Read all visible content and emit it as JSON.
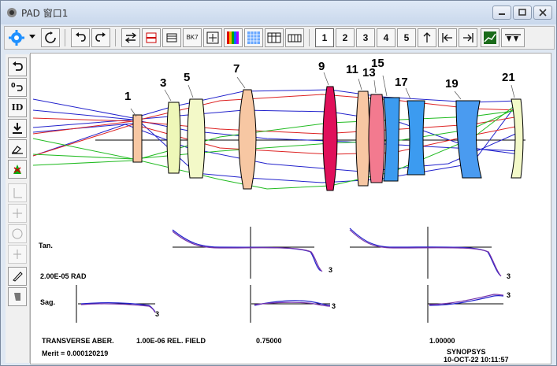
{
  "window": {
    "title": "PAD 窗口1"
  },
  "toolbar": {
    "config_numbers": [
      "1",
      "2",
      "3",
      "4",
      "5"
    ],
    "bk7_label": "BK7"
  },
  "left_toolbar": {
    "id_label": "ID"
  },
  "surface_labels": [
    "1",
    "3",
    "5",
    "7",
    "9",
    "11",
    "13",
    "15",
    "17",
    "19",
    "21"
  ],
  "plot": {
    "tan_label": "Tan.",
    "sag_label": "Sag.",
    "scale": "2.00E-05  RAD",
    "trace_end": "3",
    "footer_left": "TRANSVERSE ABER.",
    "footer_field_label": "1.00E-06  REL. FIELD",
    "field_1": "0.75000",
    "field_2": "1.00000",
    "merit": "Merit = 0.000120219",
    "brand": "SYNOPSYS",
    "datetime": "10-OCT-22  10:11:57"
  },
  "colors": {
    "ray_blue": "#2222cc",
    "ray_red": "#dd2222",
    "ray_green": "#22bb22",
    "curve_purple": "#7733aa"
  }
}
